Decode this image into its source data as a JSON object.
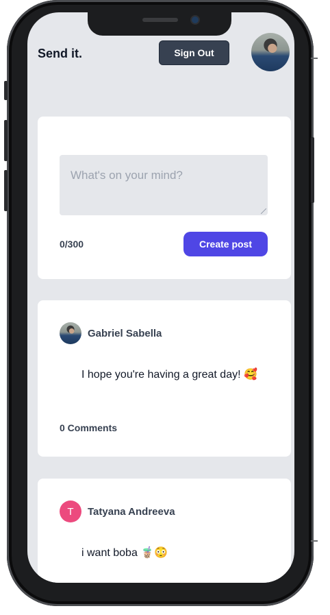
{
  "header": {
    "brand": "Send it.",
    "signout_label": "Sign Out"
  },
  "composer": {
    "placeholder": "What's on your mind?",
    "counter": "0/300",
    "submit_label": "Create post"
  },
  "posts": [
    {
      "author": "Gabriel Sabella",
      "body": "I hope you're having a great day! 🥰",
      "comments": "0 Comments"
    },
    {
      "author": "Tatyana Andreeva",
      "avatar_letter": "T",
      "body": "i want boba 🧋😳"
    }
  ],
  "colors": {
    "accent": "#4f46e5",
    "signout_bg": "#374151",
    "background": "#e5e7eb",
    "avatar_t": "#ec4a7e"
  }
}
